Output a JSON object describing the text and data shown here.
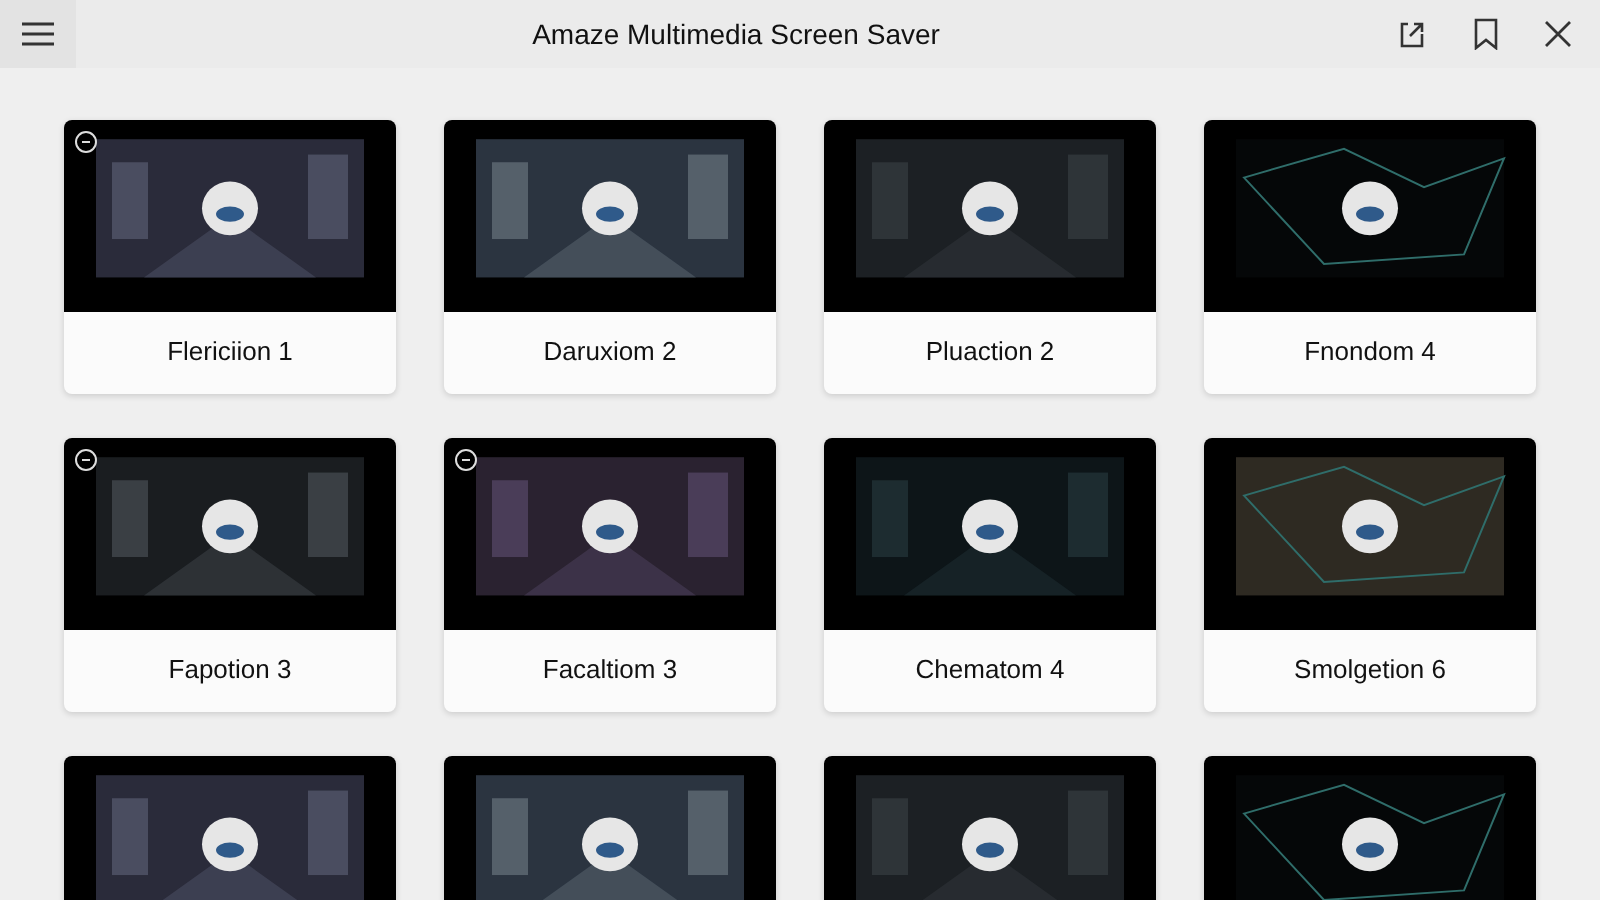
{
  "window": {
    "title": "Amaze Multimedia Screen Saver"
  },
  "tiles": [
    {
      "label": "Flericiion 1",
      "marker": true
    },
    {
      "label": "Daruxiom 2",
      "marker": false
    },
    {
      "label": "Pluaction 2",
      "marker": false
    },
    {
      "label": "Fnondom 4",
      "marker": false
    },
    {
      "label": "Fapotion 3",
      "marker": true
    },
    {
      "label": "Facaltiom 3",
      "marker": true
    },
    {
      "label": "Chematom 4",
      "marker": false
    },
    {
      "label": "Smolgetion 6",
      "marker": false
    },
    {
      "marker": false
    },
    {
      "marker": false
    },
    {
      "marker": false
    },
    {
      "marker": false
    }
  ]
}
